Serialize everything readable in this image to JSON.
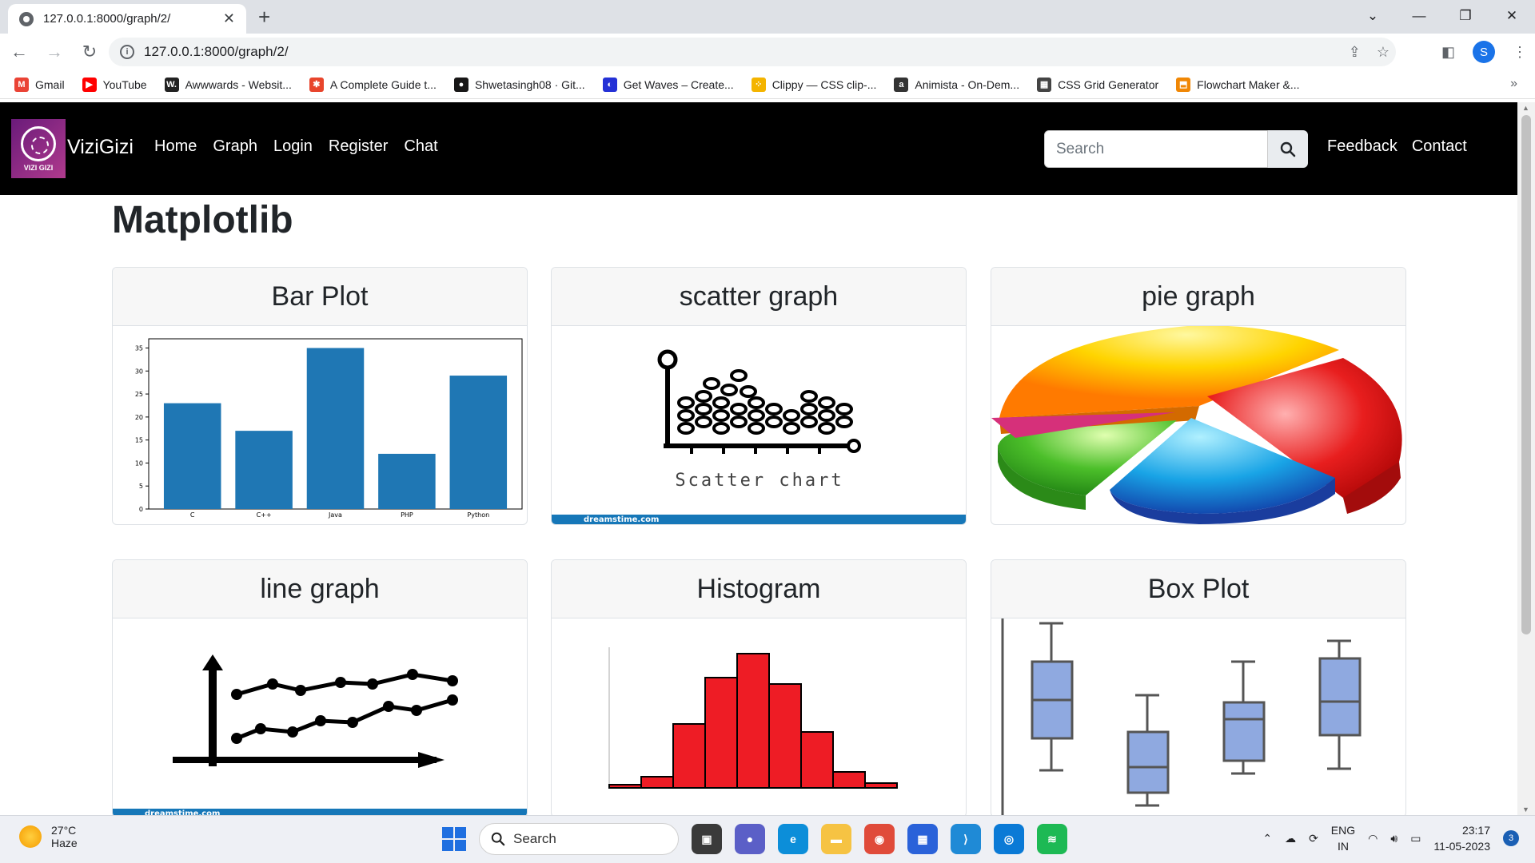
{
  "browser": {
    "tab_title": "127.0.0.1:8000/graph/2/",
    "url": "127.0.0.1:8000/graph/2/",
    "profile_initial": "S",
    "bookmarks": [
      {
        "label": "Gmail",
        "icon": "gmail-icon",
        "color": "#ea4335",
        "glyph": "M"
      },
      {
        "label": "YouTube",
        "icon": "youtube-icon",
        "color": "#ff0000",
        "glyph": "▶"
      },
      {
        "label": "Awwwards - Websit...",
        "icon": "awwwards-icon",
        "color": "#222222",
        "glyph": "W."
      },
      {
        "label": "A Complete Guide t...",
        "icon": "css-tricks-icon",
        "color": "#e8452c",
        "glyph": "✱"
      },
      {
        "label": "Shwetasingh08 · Git...",
        "icon": "github-icon",
        "color": "#181717",
        "glyph": "●"
      },
      {
        "label": "Get Waves – Create...",
        "icon": "waves-icon",
        "color": "#2431d6",
        "glyph": "◐"
      },
      {
        "label": "Clippy — CSS clip-...",
        "icon": "clippy-icon",
        "color": "#f4b400",
        "glyph": "⁘"
      },
      {
        "label": "Animista - On-Dem...",
        "icon": "animista-icon",
        "color": "#333333",
        "glyph": "a"
      },
      {
        "label": "CSS Grid Generator",
        "icon": "grid-generator-icon",
        "color": "#444444",
        "glyph": "▦"
      },
      {
        "label": "Flowchart Maker &...",
        "icon": "drawio-icon",
        "color": "#f08705",
        "glyph": "⬒"
      }
    ]
  },
  "navbar": {
    "logo_text": "VIZI GIZI",
    "brand": "ViziGizi",
    "links": [
      "Home",
      "Graph",
      "Login",
      "Register",
      "Chat"
    ],
    "search_placeholder": "Search",
    "right_links": [
      "Feedback",
      "Contact"
    ]
  },
  "page": {
    "title": "Matplotlib",
    "cards": [
      {
        "title": "Bar Plot"
      },
      {
        "title": "scatter graph",
        "caption": "Scatter chart",
        "footer": "dreamstime.com"
      },
      {
        "title": "pie graph"
      },
      {
        "title": "line graph",
        "footer": "dreamstime.com"
      },
      {
        "title": "Histogram"
      },
      {
        "title": "Box Plot"
      }
    ]
  },
  "chart_data": [
    {
      "type": "bar",
      "categories": [
        "C",
        "C++",
        "Java",
        "PHP",
        "Python"
      ],
      "values": [
        23,
        17,
        35,
        12,
        29
      ],
      "ylim": [
        0,
        37
      ],
      "yticks": [
        0,
        5,
        10,
        15,
        20,
        25,
        30,
        35
      ],
      "color": "#1f77b4"
    }
  ],
  "taskbar": {
    "temperature": "27°C",
    "condition": "Haze",
    "search_label": "Search",
    "lang_top": "ENG",
    "lang_bottom": "IN",
    "time": "23:17",
    "date": "11-05-2023",
    "notifications": "3"
  }
}
